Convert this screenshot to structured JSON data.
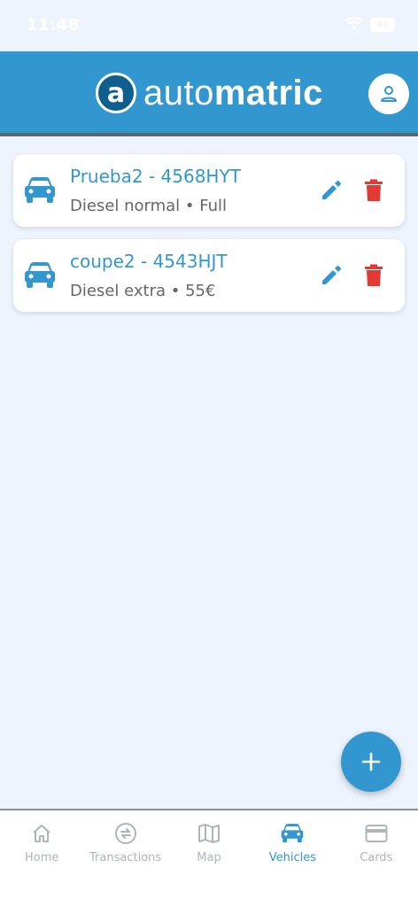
{
  "status_bar": {
    "time": "11:48",
    "battery": "84"
  },
  "header": {
    "logo_letter": "a",
    "logo_text_light": "auto",
    "logo_text_bold": "matric"
  },
  "vehicles": [
    {
      "title": "Prueba2 - 4568HYT",
      "subtitle": "Diesel normal • Full"
    },
    {
      "title": "coupe2 - 4543HJT",
      "subtitle": "Diesel extra • 55€"
    }
  ],
  "fab": {
    "label": "+"
  },
  "nav": {
    "active": "Vehicles",
    "items": [
      {
        "label": "Home",
        "icon": "home-icon"
      },
      {
        "label": "Transactions",
        "icon": "transactions-icon"
      },
      {
        "label": "Map",
        "icon": "map-icon"
      },
      {
        "label": "Vehicles",
        "icon": "car-icon"
      },
      {
        "label": "Cards",
        "icon": "card-icon"
      }
    ]
  },
  "colors": {
    "primary": "#3397cf",
    "delete": "#e53935",
    "background": "#eef4fd",
    "inactive": "#b0b4b8"
  }
}
